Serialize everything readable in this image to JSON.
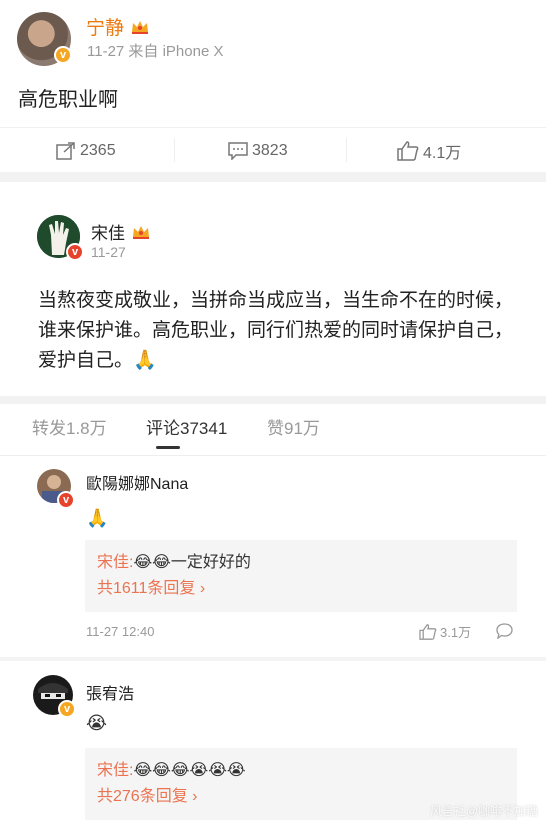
{
  "post1": {
    "author": "宁静",
    "meta": "11-27 来自 iPhone X",
    "text": "高危职业啊",
    "actions": {
      "repost": "2365",
      "comment": "3823",
      "like": "4.1万"
    }
  },
  "post2": {
    "author": "宋佳",
    "date": "11-27",
    "body": "当熬夜变成敬业，当拼命当成应当，当生命不在的时候，谁来保护谁。高危职业，同行们热爱的同时请保护自己，爱护自己。🙏"
  },
  "tabs": [
    {
      "label": "转发1.8万"
    },
    {
      "label": "评论37341"
    },
    {
      "label": "赞91万"
    }
  ],
  "comments": [
    {
      "author": "歐陽娜娜Nana",
      "emoji": "🙏",
      "reply_user": "宋佳:",
      "reply_text": "😂😂一定好好的",
      "reply_more": "共1611条回复",
      "time": "11-27 12:40",
      "likes": "3.1万"
    },
    {
      "author": "張宥浩",
      "emoji": "😭",
      "reply_user": "宋佳:",
      "reply_text": "😂😂😂😭😭😭",
      "reply_more": "共276条回复"
    }
  ],
  "watermark": "风言社@咖啡不加糖",
  "colors": {
    "accent": "#eb7350",
    "vip_name": "#ec7a12",
    "badge_gold": "#f5a623",
    "badge_red": "#e6432d"
  }
}
